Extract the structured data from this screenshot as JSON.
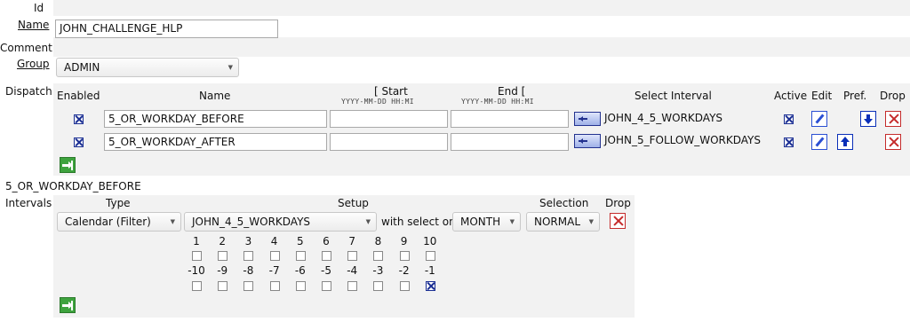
{
  "form": {
    "id_label": "Id",
    "name_label": "Name",
    "name_value": "JOHN_CHALLENGE_HLP",
    "comment_label": "Comment",
    "group_label": "Group",
    "group_value": "ADMIN",
    "dispatch_label": "Dispatch",
    "intervals_label": "Intervals"
  },
  "dispatch": {
    "headers": {
      "enabled": "Enabled",
      "name": "Name",
      "start": "[ Start",
      "end": "End [",
      "date_format": "YYYY-MM-DD HH:MI",
      "select_interval": "Select Interval",
      "active": "Active",
      "edit": "Edit",
      "pref": "Pref.",
      "drop": "Drop"
    },
    "rows": [
      {
        "name": "5_OR_WORKDAY_BEFORE",
        "start": "",
        "end": "",
        "interval": "JOHN_4_5_WORKDAYS",
        "enabled": true,
        "active": true
      },
      {
        "name": "5_OR_WORKDAY_AFTER",
        "start": "",
        "end": "",
        "interval": "JOHN_5_FOLLOW_WORKDAYS",
        "enabled": true,
        "active": true
      }
    ]
  },
  "selected_dispatch": "5_OR_WORKDAY_BEFORE",
  "intervals": {
    "headers": {
      "type": "Type",
      "setup": "Setup",
      "selection": "Selection",
      "drop": "Drop"
    },
    "type_value": "Calendar (Filter)",
    "setup_value": "JOHN_4_5_WORKDAYS",
    "with_select_on": "with select on",
    "select_on_value": "MONTH",
    "selection_value": "NORMAL",
    "positive_days": [
      "1",
      "2",
      "3",
      "4",
      "5",
      "6",
      "7",
      "8",
      "9",
      "10"
    ],
    "positive_checked": [
      false,
      false,
      false,
      false,
      false,
      false,
      false,
      false,
      false,
      false
    ],
    "negative_days": [
      "-10",
      "-9",
      "-8",
      "-7",
      "-6",
      "-5",
      "-4",
      "-3",
      "-2",
      "-1"
    ],
    "negative_checked": [
      false,
      false,
      false,
      false,
      false,
      false,
      false,
      false,
      false,
      true
    ]
  },
  "icons": {
    "edit": "pencil-icon",
    "drop": "x-icon",
    "pref_down": "arrow-down-icon",
    "pref_up": "arrow-up-icon",
    "select_interval": "select-interval-icon",
    "add": "add-row-icon"
  },
  "colors": {
    "panel_bg": "#f2f2f2",
    "checkbox_blue": "#1b2f93",
    "drop_red": "#c52b2b",
    "edit_blue": "#2a4fd3",
    "add_green": "#3ea33e"
  }
}
